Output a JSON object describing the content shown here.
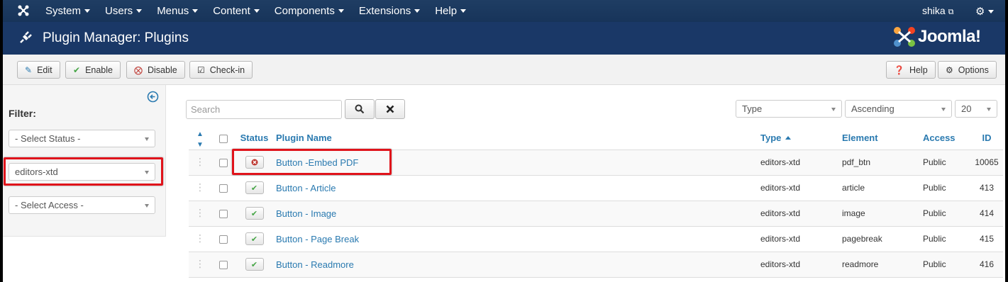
{
  "nav": {
    "menu": [
      "System",
      "Users",
      "Menus",
      "Content",
      "Components",
      "Extensions",
      "Help"
    ],
    "user": "shika"
  },
  "header": {
    "title": "Plugin Manager: Plugins",
    "brand": "Joomla!"
  },
  "toolbar": {
    "edit": "Edit",
    "enable": "Enable",
    "disable": "Disable",
    "checkin": "Check-in",
    "help": "Help",
    "options": "Options"
  },
  "sidebar": {
    "filter_label": "Filter:",
    "status_select": "- Select Status -",
    "folder_select": "editors-xtd",
    "access_select": "- Select Access -"
  },
  "search": {
    "placeholder": "Search"
  },
  "sorting": {
    "field": "Type",
    "direction": "Ascending",
    "limit": "20"
  },
  "table": {
    "columns": {
      "status": "Status",
      "name": "Plugin Name",
      "type": "Type",
      "element": "Element",
      "access": "Access",
      "id": "ID"
    },
    "rows": [
      {
        "status": "disabled",
        "name": "Button -Embed PDF",
        "type": "editors-xtd",
        "element": "pdf_btn",
        "access": "Public",
        "id": "10065"
      },
      {
        "status": "enabled",
        "name": "Button - Article",
        "type": "editors-xtd",
        "element": "article",
        "access": "Public",
        "id": "413"
      },
      {
        "status": "enabled",
        "name": "Button - Image",
        "type": "editors-xtd",
        "element": "image",
        "access": "Public",
        "id": "414"
      },
      {
        "status": "enabled",
        "name": "Button - Page Break",
        "type": "editors-xtd",
        "element": "pagebreak",
        "access": "Public",
        "id": "415"
      },
      {
        "status": "enabled",
        "name": "Button - Readmore",
        "type": "editors-xtd",
        "element": "readmore",
        "access": "Public",
        "id": "416"
      }
    ]
  },
  "colors": {
    "navbar": "#1f3d63",
    "titlebar": "#1a3867",
    "link": "#2a7ab0",
    "highlight": "#e0131b",
    "enabled": "#46a546",
    "disabled": "#bd362f"
  }
}
